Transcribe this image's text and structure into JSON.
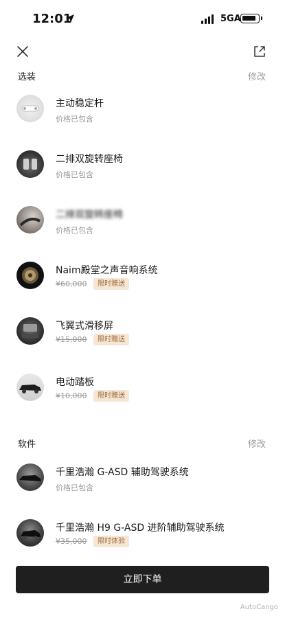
{
  "status_bar": {
    "time": "12:01",
    "network": "5GA"
  },
  "sections": [
    {
      "title": "选装",
      "edit_label": "修改",
      "items": [
        {
          "name": "主动稳定杆",
          "sub": "价格已包含",
          "icon": "stabilizer-bar-thumb"
        },
        {
          "name": "二排双旋转座椅",
          "sub": "价格已包含",
          "icon": "rotating-seat-thumb"
        },
        {
          "name": "二排双旋转座椅",
          "sub": "价格已包含",
          "icon": "interior-thumb",
          "blurred_name": true
        },
        {
          "name": "Naim殿堂之声音响系统",
          "old_price": "¥60,000",
          "badge": "限时赠送",
          "icon": "speaker-thumb"
        },
        {
          "name": "飞翼式滑移屏",
          "old_price": "¥15,000",
          "badge": "限时赠送",
          "icon": "sliding-screen-thumb"
        },
        {
          "name": "电动踏板",
          "old_price": "¥10,000",
          "badge": "限时赠送",
          "icon": "running-board-thumb"
        }
      ]
    },
    {
      "title": "软件",
      "edit_label": "修改",
      "items": [
        {
          "name": "千里浩瀚 G-ASD 辅助驾驶系统",
          "sub": "价格已包含",
          "icon": "adas-thumb"
        },
        {
          "name": "千里浩瀚 H9 G-ASD 进阶辅助驾驶系统",
          "old_price": "¥35,000",
          "badge": "限时体验",
          "icon": "advanced-adas-thumb"
        }
      ]
    }
  ],
  "order_button": {
    "label": "立即下单"
  },
  "watermark": "AutoCango"
}
